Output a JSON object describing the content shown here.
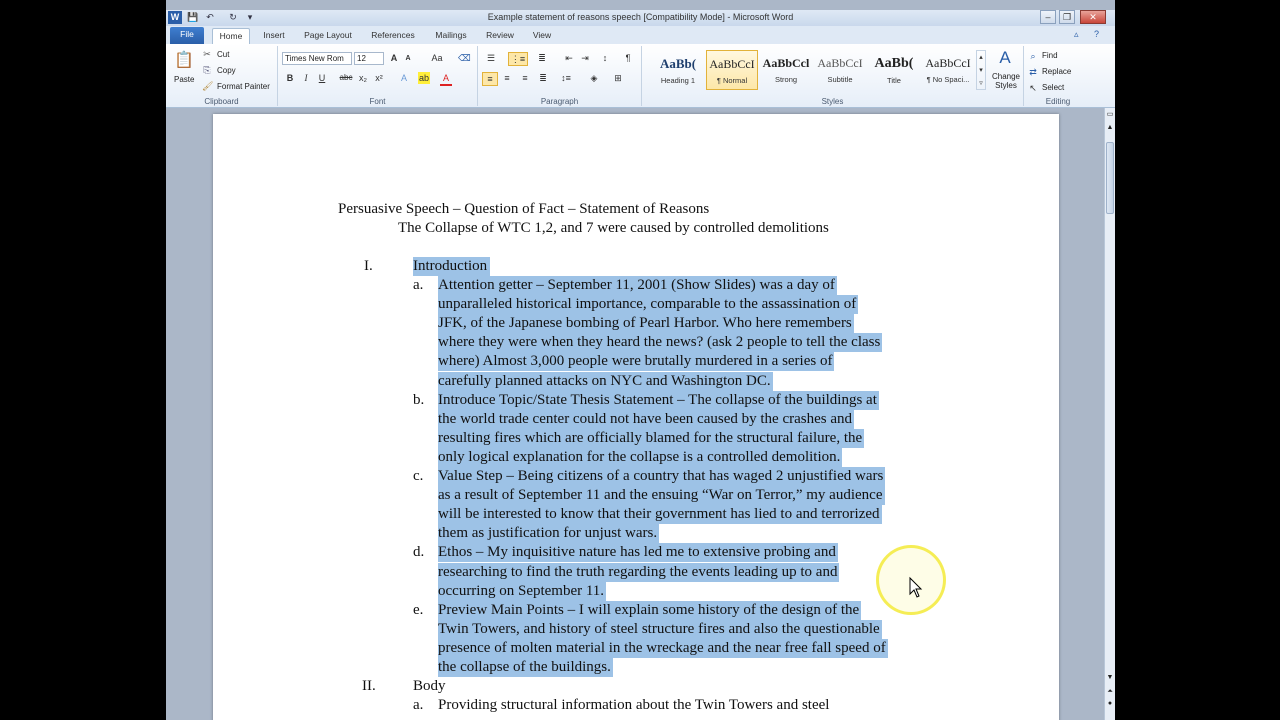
{
  "window": {
    "title": "Example statement of reasons speech [Compatibility Mode] - Microsoft Word",
    "controls": {
      "minimize": "–",
      "restore": "❐",
      "close": "✕"
    }
  },
  "quick_access": {
    "app_icon": "W",
    "save": "💾",
    "undo": "↶",
    "redo": "↻"
  },
  "tabs": [
    "File",
    "Home",
    "Insert",
    "Page Layout",
    "References",
    "Mailings",
    "Review",
    "View"
  ],
  "active_tab": "Home",
  "clipboard": {
    "paste": "Paste",
    "cut": "Cut",
    "copy": "Copy",
    "format_painter": "Format Painter",
    "label": "Clipboard"
  },
  "font": {
    "name": "Times New Rom",
    "size": "12",
    "grow": "A",
    "shrink": "A",
    "case": "Aa",
    "bold": "B",
    "italic": "I",
    "underline": "U",
    "strike": "abc",
    "subscript": "x₂",
    "superscript": "x²",
    "label": "Font"
  },
  "paragraph": {
    "label": "Paragraph",
    "pilcrow": "¶"
  },
  "styles": {
    "label": "Styles",
    "items": [
      {
        "sample": "AaBb(",
        "name": "Heading 1"
      },
      {
        "sample": "AaBbCcI",
        "name": "¶ Normal"
      },
      {
        "sample": "AaBbCcl",
        "name": "Strong"
      },
      {
        "sample": "AaBbCcI",
        "name": "Subtitle"
      },
      {
        "sample": "AaBb(",
        "name": "Title"
      },
      {
        "sample": "AaBbCcI",
        "name": "¶ No Spaci..."
      }
    ],
    "change_styles": "Change Styles"
  },
  "editing": {
    "find": "Find",
    "replace": "Replace",
    "select": "Select",
    "label": "Editing"
  },
  "document": {
    "title_line": "Persuasive Speech – Question of Fact – Statement of Reasons",
    "subtitle_line": "The Collapse of WTC 1,2, and 7 were caused by controlled demolitions",
    "section1_num": "I.",
    "section1_title": "Introduction",
    "items": [
      {
        "letter": "a.",
        "lines": [
          "Attention getter – September 11, 2001 (Show Slides) was a day of",
          "unparalleled historical importance, comparable to the assassination of",
          "JFK, of the Japanese bombing of Pearl Harbor.  Who here remembers",
          "where they were when they heard the news? (ask 2 people to tell the class",
          "where) Almost 3,000 people were brutally murdered in a series of",
          "carefully planned attacks on NYC and Washington DC."
        ]
      },
      {
        "letter": "b.",
        "lines": [
          "Introduce Topic/State Thesis Statement – The collapse of the buildings at",
          "the world trade center could not have been caused by the crashes and",
          "resulting fires which are officially blamed for the structural failure, the",
          "only logical explanation for the collapse is a controlled demolition."
        ]
      },
      {
        "letter": "c.",
        "lines": [
          "Value Step – Being citizens of a country that has waged 2 unjustified wars",
          "as a result of September 11 and the ensuing “War on Terror,” my audience",
          "will be interested to know that their government has lied to and terrorized",
          "them as justification  for unjust wars."
        ]
      },
      {
        "letter": "d.",
        "lines": [
          "Ethos – My inquisitive nature has led me to extensive probing and",
          "researching to find the truth regarding the events leading up to and",
          "occurring on September 11."
        ]
      },
      {
        "letter": "e.",
        "lines": [
          "Preview Main Points – I will explain some history of the design of the",
          "Twin Towers, and history of steel structure fires and also the questionable",
          "presence of molten material in the wreckage and the near free fall speed of",
          "the collapse of the buildings."
        ]
      }
    ],
    "section2_num": "II.",
    "section2_title": "Body",
    "section2_item_letter": "a.",
    "section2_item_text": "Providing structural information about the Twin Towers and steel"
  }
}
